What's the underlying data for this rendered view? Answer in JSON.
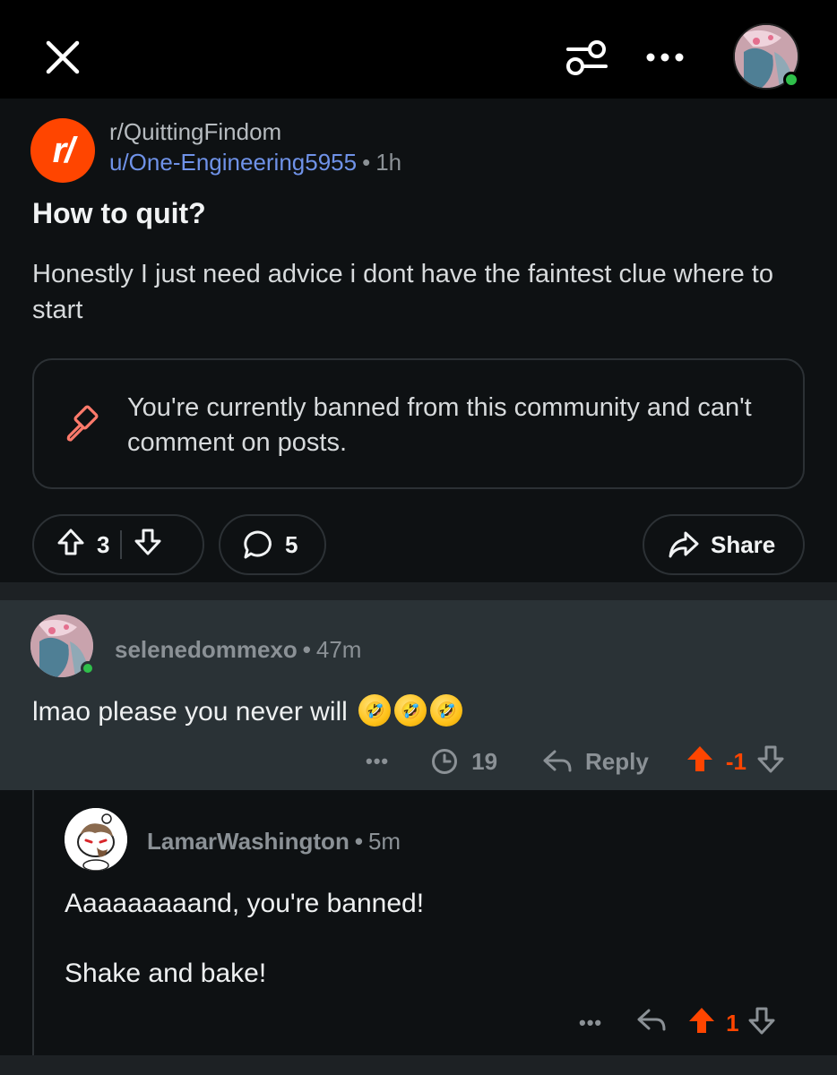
{
  "topbar": {
    "close_icon": "close-icon",
    "filter_icon": "filter-icon",
    "more_icon": "more-icon",
    "avatar_status": "online"
  },
  "post": {
    "subreddit_icon_text": "r/",
    "subreddit": "r/QuittingFindom",
    "author": "u/One-Engineering5955",
    "separator": "•",
    "time": "1h",
    "title": "How to quit?",
    "body": "Honestly I just need advice i dont have the faintest clue where to start",
    "ban_notice": "You're currently banned from this community and can't comment on posts.",
    "vote_count": "3",
    "comment_count": "5",
    "share_label": "Share"
  },
  "comments": [
    {
      "username": "selenedommexo",
      "separator": "•",
      "time": "47m",
      "text": "lmao please you never will",
      "emoji": [
        "🤣",
        "🤣",
        "🤣"
      ],
      "more_label": "•••",
      "award_count": "19",
      "reply_label": "Reply",
      "score": "-1"
    },
    {
      "username": "LamarWashington",
      "separator": "•",
      "time": "5m",
      "text_line1": "Aaaaaaaaand, you're banned!",
      "text_line2": "Shake and bake!",
      "more_label": "•••",
      "score": "1"
    }
  ],
  "colors": {
    "accent": "#ff4500",
    "author_link": "#6f92e8",
    "online": "#2fbf4a",
    "highlight_bg": "#2a3236"
  }
}
